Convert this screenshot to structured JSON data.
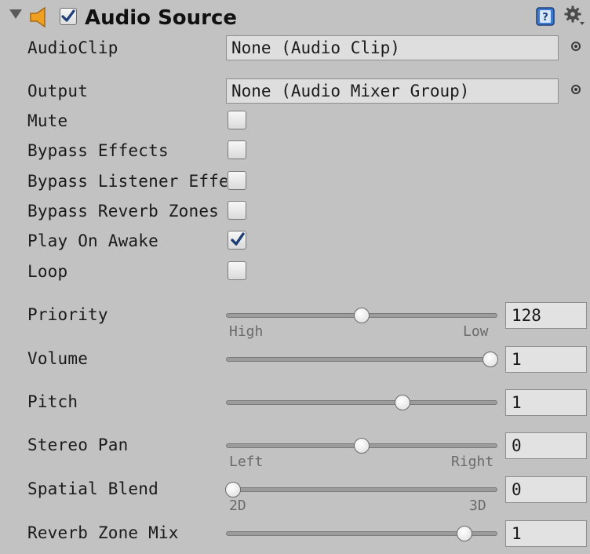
{
  "component": {
    "title": "Audio Source",
    "enabled": true
  },
  "icons": {
    "foldout": "foldout-triangle-icon",
    "component": "speaker-icon",
    "help": "help-book-icon",
    "settings": "gear-icon",
    "object_picker": "object-picker-icon"
  },
  "fields": {
    "audio_clip": {
      "label": "AudioClip",
      "value": "None (Audio Clip)"
    },
    "output": {
      "label": "Output",
      "value": "None (Audio Mixer Group)"
    }
  },
  "toggles": [
    {
      "label": "Mute",
      "checked": false
    },
    {
      "label": "Bypass Effects",
      "checked": false
    },
    {
      "label": "Bypass Listener Effects",
      "checked": false
    },
    {
      "label": "Bypass Reverb Zones",
      "checked": false
    },
    {
      "label": "Play On Awake",
      "checked": true
    },
    {
      "label": "Loop",
      "checked": false
    }
  ],
  "sliders": [
    {
      "label": "Priority",
      "value": "128",
      "fraction": 0.5,
      "min_label": "High",
      "max_label": "Low"
    },
    {
      "label": "Volume",
      "value": "1",
      "fraction": 1.0
    },
    {
      "label": "Pitch",
      "value": "1",
      "fraction": 0.66
    },
    {
      "label": "Stereo Pan",
      "value": "0",
      "fraction": 0.5,
      "min_label": "Left",
      "max_label": "Right"
    },
    {
      "label": "Spatial Blend",
      "value": "0",
      "fraction": 0.0,
      "min_label": "2D",
      "max_label": "3D"
    },
    {
      "label": "Reverb Zone Mix",
      "value": "1",
      "fraction": 0.9
    }
  ],
  "colors": {
    "panel_bg": "#c2c2c2",
    "check_blue": "#1e3e78",
    "speaker_orange": "#f0a020"
  }
}
